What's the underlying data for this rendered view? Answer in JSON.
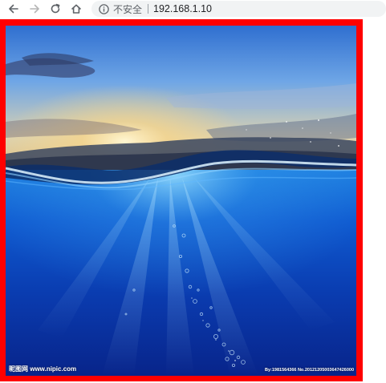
{
  "browser": {
    "back_icon": "arrow-left-icon",
    "forward_icon": "arrow-right-icon",
    "reload_icon": "reload-icon",
    "home_icon": "home-icon",
    "info_icon": "info-circle-icon",
    "security_label": "不安全",
    "url": "192.168.1.10"
  },
  "page": {
    "frame_color": "#ff0000",
    "photo": {
      "watermark_left": "昵图网 www.nipic.com",
      "watermark_right": "By:1981564366 No.20121205003647426000"
    }
  }
}
